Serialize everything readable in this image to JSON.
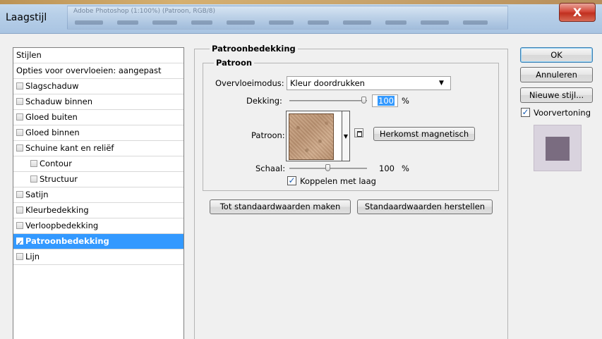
{
  "window": {
    "title": "Laagstijl",
    "background_title": "Adobe Photoshop (1:100%) (Patroon, RGB/8)",
    "close_glyph": "X"
  },
  "styles_list": {
    "header": "Stijlen",
    "blend_options": "Opties voor overvloeien: aangepast",
    "items": [
      {
        "label": "Slagschaduw",
        "checked": false,
        "indent": false,
        "selected": false
      },
      {
        "label": "Schaduw binnen",
        "checked": false,
        "indent": false,
        "selected": false
      },
      {
        "label": "Gloed buiten",
        "checked": false,
        "indent": false,
        "selected": false
      },
      {
        "label": "Gloed binnen",
        "checked": false,
        "indent": false,
        "selected": false
      },
      {
        "label": "Schuine kant en reliëf",
        "checked": false,
        "indent": false,
        "selected": false
      },
      {
        "label": "Contour",
        "checked": false,
        "indent": true,
        "selected": false
      },
      {
        "label": "Structuur",
        "checked": false,
        "indent": true,
        "selected": false
      },
      {
        "label": "Satijn",
        "checked": false,
        "indent": false,
        "selected": false
      },
      {
        "label": "Kleurbedekking",
        "checked": false,
        "indent": false,
        "selected": false
      },
      {
        "label": "Verloopbedekking",
        "checked": false,
        "indent": false,
        "selected": false
      },
      {
        "label": "Patroonbedekking",
        "checked": true,
        "indent": false,
        "selected": true
      },
      {
        "label": "Lijn",
        "checked": false,
        "indent": false,
        "selected": false
      }
    ]
  },
  "panel": {
    "title": "Patroonbedekking",
    "group_title": "Patroon",
    "blend_mode_label": "Overvloeimodus:",
    "blend_mode_value": "Kleur doordrukken",
    "opacity_label": "Dekking:",
    "opacity_value": "100",
    "opacity_unit": "%",
    "opacity_level": 1.0,
    "pattern_label": "Patroon:",
    "snap_origin_button": "Herkomst magnetisch",
    "scale_label": "Schaal:",
    "scale_value": "100",
    "scale_unit": "%",
    "scale_level": 0.5,
    "link_with_layer_label": "Koppelen met laag",
    "link_with_layer_checked": true,
    "make_default_button": "Tot standaardwaarden maken",
    "reset_default_button": "Standaardwaarden herstellen"
  },
  "actions": {
    "ok": "OK",
    "cancel": "Annuleren",
    "new_style": "Nieuwe stijl...",
    "preview_label": "Voorvertoning",
    "preview_checked": true
  },
  "colors": {
    "selection": "#3399ff",
    "preview_bg": "#d9d3de",
    "preview_swatch": "#7a6c80"
  }
}
